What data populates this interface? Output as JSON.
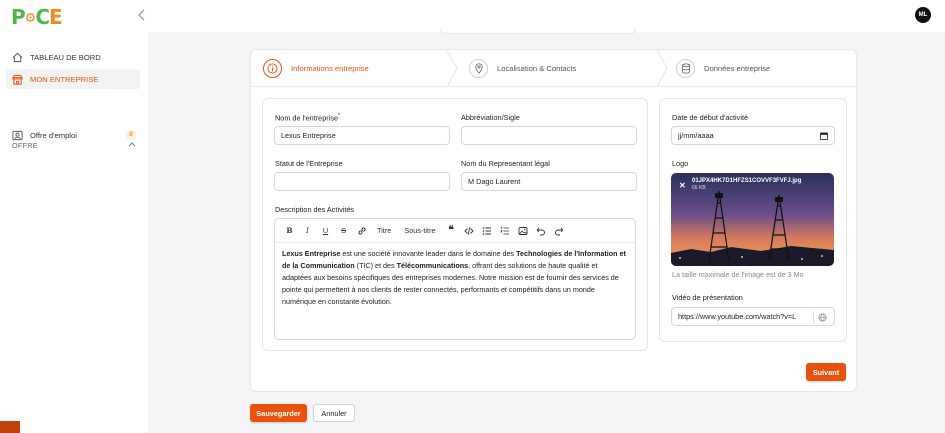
{
  "brand": {
    "logo_p": "P",
    "logo_c": "C",
    "logo_e": "E",
    "green": "#4db848",
    "orange": "#ef8a1e"
  },
  "user": {
    "initials": "ML"
  },
  "sidebar": {
    "items": [
      {
        "label": "TABLEAU DE BORD",
        "icon": "dashboard-icon"
      },
      {
        "label": "MON ENTREPRISE",
        "icon": "store-icon"
      }
    ],
    "section": "OFFRE",
    "sub_items": [
      {
        "label": "Offre d'emploi",
        "icon": "user-card-icon",
        "badge": "0"
      }
    ]
  },
  "steps": [
    {
      "label": "Informations entreprise",
      "icon": "info-icon"
    },
    {
      "label": "Localisation & Contacts",
      "icon": "map-pin-icon"
    },
    {
      "label": "Données entreprise",
      "icon": "database-icon"
    }
  ],
  "form": {
    "company_name_label": "Nom de l'entreprise",
    "company_name_req": "*",
    "company_name_value": "Lexus Entreprise",
    "abbr_label": "Abbréviation/Sigle",
    "abbr_value": "",
    "status_label": "Statut de l'Entreprise",
    "status_value": "",
    "rep_label": "Nom du Representant légal",
    "rep_value": "M Dago Laurent",
    "desc_label": "Description des Activités",
    "toolbar_titre": "Titre",
    "toolbar_soustitre": "Sous-titre",
    "desc": {
      "b1": "Lexus Entreprise",
      "t1": " est une société innovante leader dans le domaine des ",
      "b2": "Technologies de l'Information et de la Communication",
      "t2": " (TIC) et des ",
      "b3": "Télécommunications",
      "t3": ", offrant des solutions de haute qualité et adaptées aux besoins spécifiques des entreprises modernes. Notre mission est de fournir des services de pointe qui permettent à nos clients de rester connectés, performants et compétitifs dans un monde numérique en constante évolution."
    },
    "start_date_label": "Date de début d'activité",
    "start_date_placeholder": "jj/mm/aaaa",
    "logo_label": "Logo",
    "logo_file": "01JPX4HK7D1HFZS1COVVF3FVFJ.jpg",
    "logo_size": "66 KB",
    "logo_note": "La taille maximale de l'image est de 3 Mo",
    "video_label": "Vidéo de présentation",
    "video_value": "https://www.youtube.com/watch?v=L"
  },
  "buttons": {
    "next": "Suivant",
    "save": "Sauvegarder",
    "cancel": "Annuler"
  },
  "colors": {
    "accent": "#e8520e"
  }
}
